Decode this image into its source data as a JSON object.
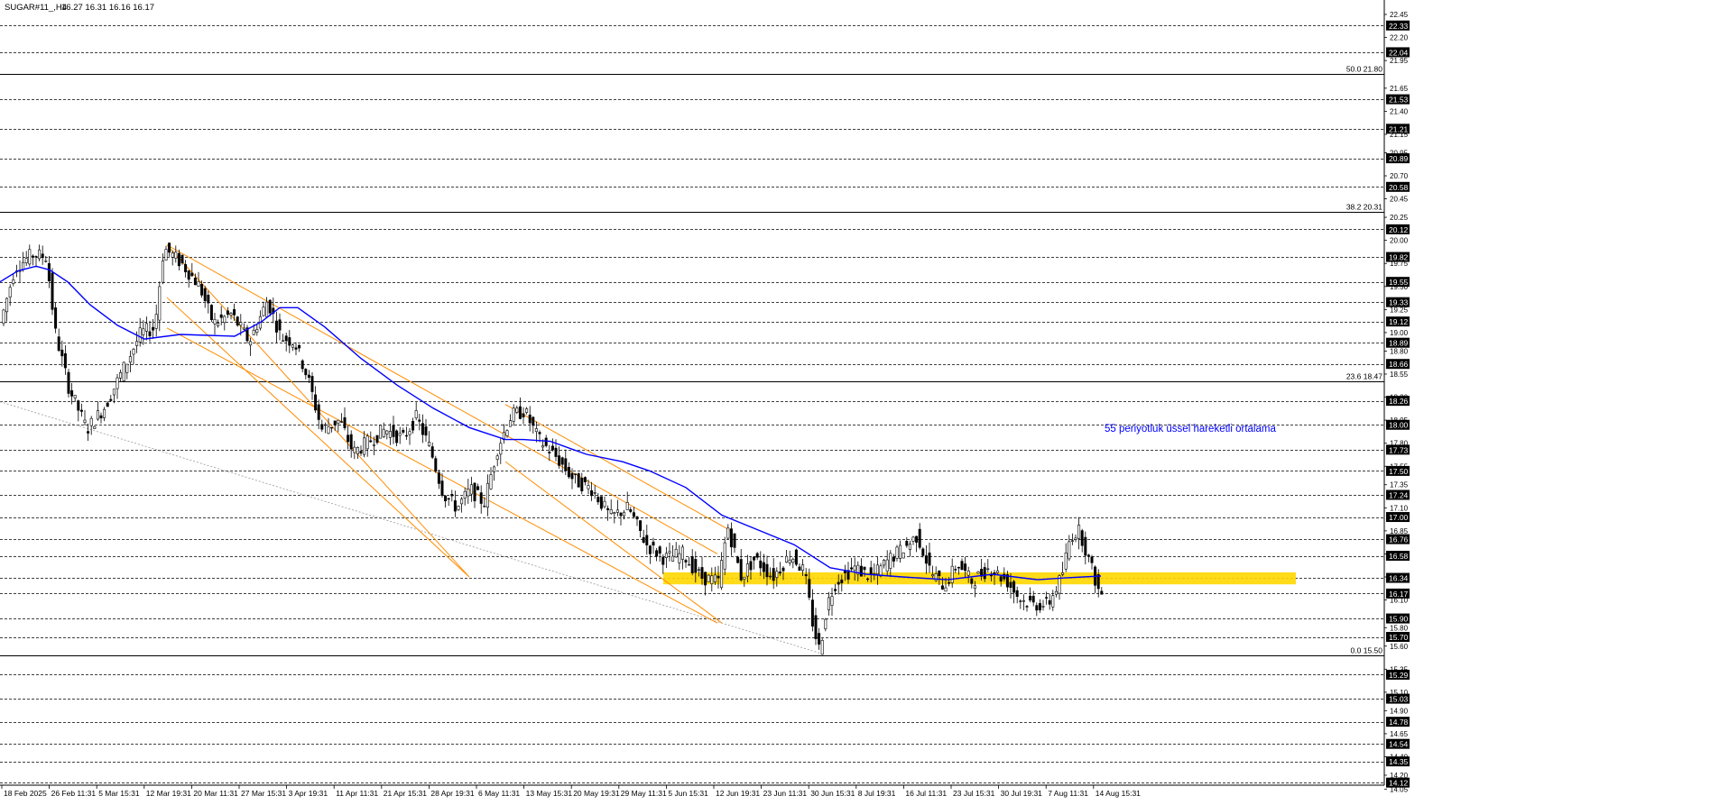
{
  "header": {
    "symbol": "SUGAR#11_,H4",
    "ohlc": "16.27 16.31 16.16 16.17"
  },
  "annotation": "55 periyotluk üssel hareketli ortalama",
  "colors": {
    "up_candle": "#ffffff",
    "down_candle": "#000000",
    "candle_outline": "#000000",
    "ema_line": "#0000ff",
    "channel_lines": "#ff8c00",
    "support_zone": "#ffd700",
    "annotation_text": "#0000ff",
    "price_tag_bg": "#000000",
    "price_tag_text": "#ffffff",
    "grid_dashed": "#000000",
    "background": "#ffffff"
  },
  "chart_data": {
    "type": "candlestick",
    "timeframe": "H4",
    "ylim": [
      14.05,
      22.45
    ],
    "x_tick_labels": [
      "18 Feb 2025",
      "26 Feb 11:31",
      "5 Mar 15:31",
      "12 Mar 19:31",
      "20 Mar 11:31",
      "27 Mar 15:31",
      "3 Apr 19:31",
      "11 Apr 11:31",
      "21 Apr 15:31",
      "28 Apr 19:31",
      "6 May 11:31",
      "13 May 15:31",
      "20 May 19:31",
      "29 May 11:31",
      "5 Jun 15:31",
      "12 Jun 19:31",
      "23 Jun 11:31",
      "30 Jun 15:31",
      "8 Jul 19:31",
      "16 Jul 11:31",
      "23 Jul 15:31",
      "30 Jul 19:31",
      "7 Aug 11:31",
      "14 Aug 15:31"
    ],
    "y_tick_labels": [
      "22.45",
      "22.20",
      "21.95",
      "21.65",
      "21.40",
      "21.15",
      "20.95",
      "20.70",
      "20.45",
      "20.25",
      "20.00",
      "19.75",
      "19.50",
      "19.25",
      "19.00",
      "18.80",
      "18.55",
      "18.30",
      "18.05",
      "17.80",
      "17.55",
      "17.35",
      "17.10",
      "16.85",
      "16.60",
      "16.35",
      "16.10",
      "15.80",
      "15.60",
      "15.35",
      "15.10",
      "14.90",
      "14.65",
      "14.40",
      "14.20",
      "14.05"
    ],
    "horizontal_levels": [
      "22.33",
      "22.04",
      "21.53",
      "21.21",
      "20.89",
      "20.58",
      "20.12",
      "19.82",
      "19.55",
      "19.33",
      "19.12",
      "18.89",
      "18.66",
      "18.26",
      "18.00",
      "17.73",
      "17.50",
      "17.24",
      "17.00",
      "16.76",
      "16.58",
      "16.34",
      "16.17",
      "15.90",
      "15.70",
      "15.29",
      "15.03",
      "14.78",
      "14.54",
      "14.35",
      "14.12"
    ],
    "fibonacci_levels": [
      {
        "label": "50.0 21.80",
        "value": 21.8
      },
      {
        "label": "38.2 20.31",
        "value": 20.31
      },
      {
        "label": "23.6 18.47",
        "value": 18.47
      },
      {
        "label": "0.0 15.50",
        "value": 15.5
      }
    ],
    "support_zone": [
      16.27,
      16.4
    ],
    "ema_period": 55,
    "ema_path": [
      [
        0,
        19.55
      ],
      [
        20,
        19.67
      ],
      [
        40,
        19.72
      ],
      [
        55,
        19.68
      ],
      [
        75,
        19.55
      ],
      [
        100,
        19.3
      ],
      [
        130,
        19.08
      ],
      [
        160,
        18.93
      ],
      [
        200,
        18.98
      ],
      [
        230,
        18.97
      ],
      [
        260,
        18.96
      ],
      [
        290,
        19.12
      ],
      [
        310,
        19.27
      ],
      [
        330,
        19.27
      ],
      [
        360,
        19.06
      ],
      [
        400,
        18.72
      ],
      [
        440,
        18.43
      ],
      [
        480,
        18.18
      ],
      [
        520,
        17.97
      ],
      [
        560,
        17.84
      ],
      [
        580,
        17.84
      ],
      [
        610,
        17.82
      ],
      [
        650,
        17.68
      ],
      [
        690,
        17.6
      ],
      [
        720,
        17.5
      ],
      [
        760,
        17.32
      ],
      [
        800,
        17.02
      ],
      [
        840,
        16.86
      ],
      [
        880,
        16.7
      ],
      [
        920,
        16.45
      ],
      [
        960,
        16.38
      ],
      [
        1000,
        16.35
      ],
      [
        1050,
        16.32
      ],
      [
        1100,
        16.38
      ],
      [
        1150,
        16.32
      ],
      [
        1180,
        16.34
      ],
      [
        1220,
        16.36
      ]
    ],
    "price_path": [
      [
        0,
        18.95
      ],
      [
        20,
        19.7
      ],
      [
        40,
        19.85
      ],
      [
        55,
        19.82
      ],
      [
        65,
        19.0
      ],
      [
        80,
        18.4
      ],
      [
        100,
        17.95
      ],
      [
        120,
        18.2
      ],
      [
        140,
        18.6
      ],
      [
        160,
        19.0
      ],
      [
        175,
        19.05
      ],
      [
        185,
        19.92
      ],
      [
        205,
        19.75
      ],
      [
        225,
        19.5
      ],
      [
        240,
        19.1
      ],
      [
        260,
        19.2
      ],
      [
        280,
        18.9
      ],
      [
        300,
        19.35
      ],
      [
        315,
        18.95
      ],
      [
        330,
        18.9
      ],
      [
        345,
        18.5
      ],
      [
        360,
        17.95
      ],
      [
        380,
        18.05
      ],
      [
        395,
        17.7
      ],
      [
        410,
        17.8
      ],
      [
        430,
        17.95
      ],
      [
        450,
        17.85
      ],
      [
        465,
        18.08
      ],
      [
        480,
        17.75
      ],
      [
        495,
        17.25
      ],
      [
        510,
        17.1
      ],
      [
        525,
        17.3
      ],
      [
        540,
        17.15
      ],
      [
        555,
        17.75
      ],
      [
        570,
        18.1
      ],
      [
        585,
        18.15
      ],
      [
        600,
        17.85
      ],
      [
        620,
        17.65
      ],
      [
        640,
        17.4
      ],
      [
        660,
        17.3
      ],
      [
        680,
        17.0
      ],
      [
        700,
        17.1
      ],
      [
        720,
        16.7
      ],
      [
        740,
        16.55
      ],
      [
        760,
        16.6
      ],
      [
        780,
        16.35
      ],
      [
        800,
        16.3
      ],
      [
        810,
        16.9
      ],
      [
        825,
        16.35
      ],
      [
        840,
        16.55
      ],
      [
        860,
        16.35
      ],
      [
        880,
        16.6
      ],
      [
        895,
        16.4
      ],
      [
        905,
        15.8
      ],
      [
        912,
        15.55
      ],
      [
        920,
        16.05
      ],
      [
        930,
        16.3
      ],
      [
        950,
        16.45
      ],
      [
        970,
        16.35
      ],
      [
        990,
        16.55
      ],
      [
        1010,
        16.7
      ],
      [
        1020,
        16.8
      ],
      [
        1035,
        16.4
      ],
      [
        1050,
        16.25
      ],
      [
        1065,
        16.5
      ],
      [
        1080,
        16.3
      ],
      [
        1100,
        16.45
      ],
      [
        1120,
        16.3
      ],
      [
        1135,
        16.1
      ],
      [
        1150,
        16.05
      ],
      [
        1165,
        16.05
      ],
      [
        1180,
        16.35
      ],
      [
        1190,
        16.8
      ],
      [
        1200,
        16.85
      ],
      [
        1210,
        16.55
      ],
      [
        1222,
        16.17
      ]
    ],
    "fan_lines": [
      {
        "from": [
          0,
          18.25
        ],
        "to": [
          910,
          15.52
        ]
      }
    ],
    "channels": [
      {
        "upper": [
          [
            185,
            19.95
          ],
          [
            520,
            16.35
          ]
        ],
        "lower": [
          [
            185,
            19.38
          ],
          [
            520,
            16.35
          ]
        ],
        "mid_upper": [
          [
            185,
            19.95
          ],
          [
            795,
            16.6
          ]
        ],
        "mid_lower": [
          [
            185,
            19.05
          ],
          [
            795,
            15.85
          ]
        ]
      },
      {
        "upper": [
          [
            560,
            18.22
          ],
          [
            810,
            16.85
          ]
        ],
        "lower": [
          [
            560,
            17.6
          ],
          [
            800,
            15.85
          ]
        ]
      }
    ]
  }
}
